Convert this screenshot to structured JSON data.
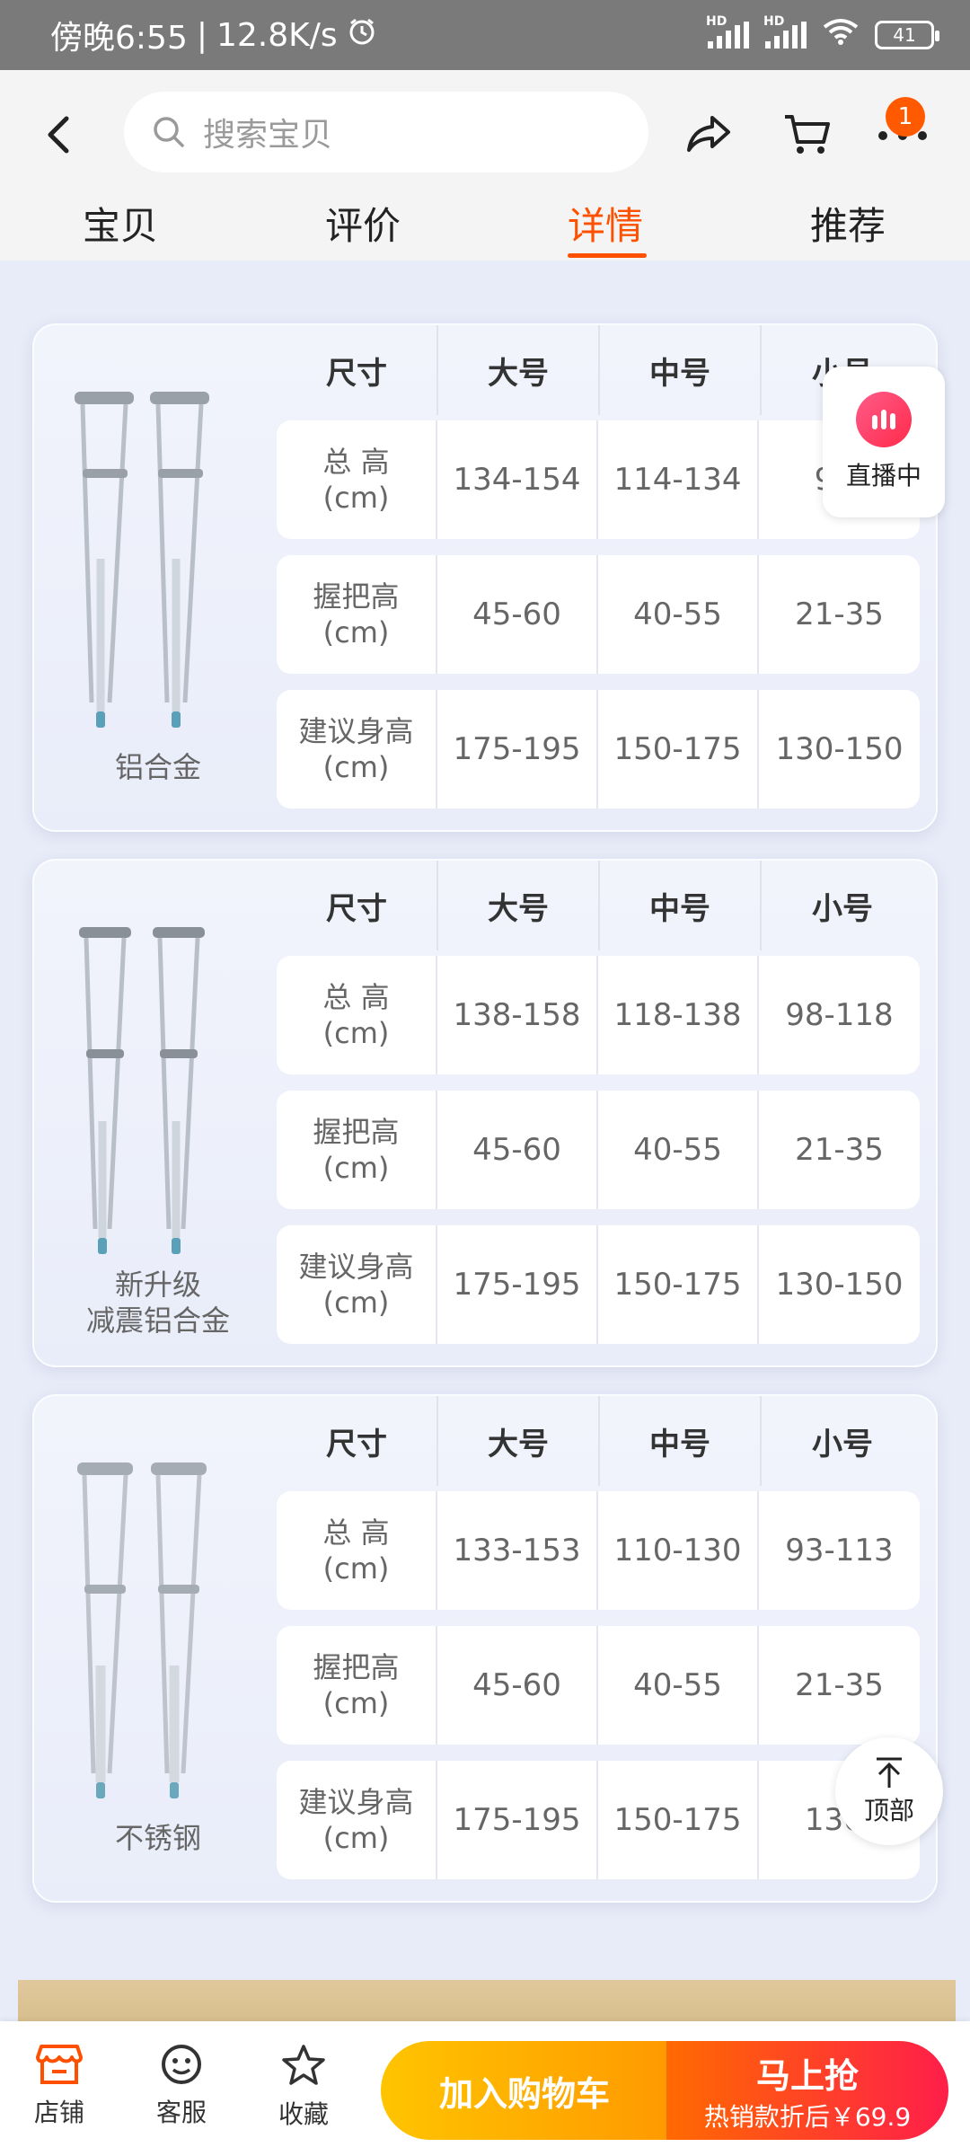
{
  "status": {
    "time": "傍晚6:55",
    "speed": "12.8K/s",
    "hd1": "HD",
    "hd2": "HD",
    "battery": "41"
  },
  "header": {
    "search_placeholder": "搜索宝贝",
    "cart_badge": "1",
    "tabs": [
      "宝贝",
      "评价",
      "详情",
      "推荐"
    ],
    "active_tab": "详情"
  },
  "tables": [
    {
      "material": "铝合金",
      "headers": [
        "尺寸",
        "大号",
        "中号",
        "小号"
      ],
      "rows": [
        {
          "label1": "总 高",
          "label2": "(cm)",
          "values": [
            "134-154",
            "114-134",
            "94-"
          ]
        },
        {
          "label1": "握把高",
          "label2": "(cm)",
          "values": [
            "45-60",
            "40-55",
            "21-35"
          ]
        },
        {
          "label1": "建议身高",
          "label2": "(cm)",
          "values": [
            "175-195",
            "150-175",
            "130-150"
          ]
        }
      ]
    },
    {
      "material": "新升级",
      "material2": "减震铝合金",
      "headers": [
        "尺寸",
        "大号",
        "中号",
        "小号"
      ],
      "rows": [
        {
          "label1": "总 高",
          "label2": "(cm)",
          "values": [
            "138-158",
            "118-138",
            "98-118"
          ]
        },
        {
          "label1": "握把高",
          "label2": "(cm)",
          "values": [
            "45-60",
            "40-55",
            "21-35"
          ]
        },
        {
          "label1": "建议身高",
          "label2": "(cm)",
          "values": [
            "175-195",
            "150-175",
            "130-150"
          ]
        }
      ]
    },
    {
      "material": "不锈钢",
      "headers": [
        "尺寸",
        "大号",
        "中号",
        "小号"
      ],
      "rows": [
        {
          "label1": "总 高",
          "label2": "(cm)",
          "values": [
            "133-153",
            "110-130",
            "93-113"
          ]
        },
        {
          "label1": "握把高",
          "label2": "(cm)",
          "values": [
            "45-60",
            "40-55",
            "21-35"
          ]
        },
        {
          "label1": "建议身高",
          "label2": "(cm)",
          "values": [
            "175-195",
            "150-175",
            "130-"
          ]
        }
      ]
    }
  ],
  "floats": {
    "live": "直播中",
    "top": "顶部"
  },
  "bottom": {
    "shop": "店铺",
    "service": "客服",
    "favorite": "收藏",
    "add_cart": "加入购物车",
    "buy_main": "马上抢",
    "buy_sub": "热销款折后￥69.9"
  },
  "colors": {
    "accent": "#ff5000",
    "cart_gradient_start": "#ffc400",
    "buy_gradient_end": "#ff1e4a"
  }
}
